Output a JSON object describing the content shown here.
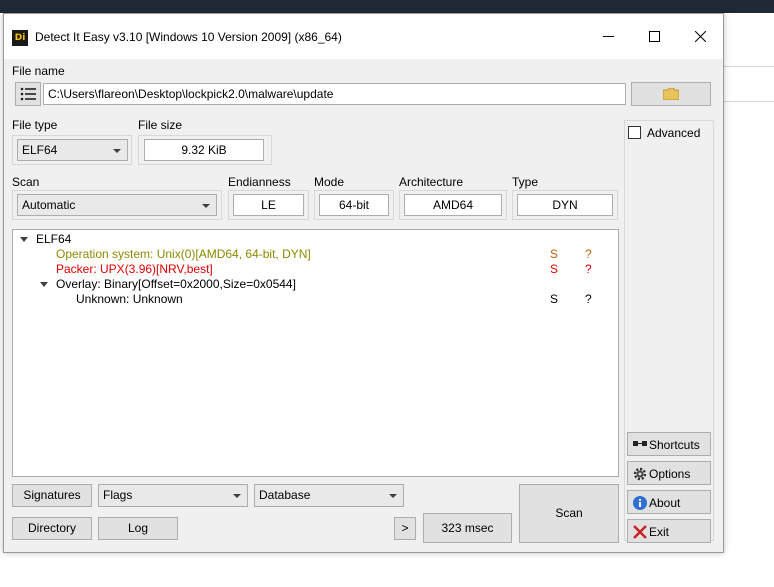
{
  "window": {
    "title": "Detect It Easy v3.10 [Windows 10 Version 2009] (x86_64)",
    "icon_text": "Di",
    "controls": [
      "minimize-icon",
      "maximize-icon",
      "close-icon"
    ]
  },
  "file_name": {
    "label": "File name",
    "value": "C:\\Users\\flareon\\Desktop\\lockpick2.0\\malware\\update"
  },
  "file_type": {
    "label": "File type",
    "value": "ELF64"
  },
  "file_size": {
    "label": "File size",
    "value": "9.32 KiB"
  },
  "scan": {
    "label": "Scan",
    "value": "Automatic"
  },
  "endianness": {
    "label": "Endianness",
    "value": "LE"
  },
  "mode": {
    "label": "Mode",
    "value": "64-bit"
  },
  "architecture": {
    "label": "Architecture",
    "value": "AMD64"
  },
  "type": {
    "label": "Type",
    "value": "DYN"
  },
  "advanced": {
    "label": "Advanced",
    "checked": false
  },
  "results": [
    {
      "text": "ELF64",
      "level": 0,
      "color": "#000000",
      "s": "",
      "q": "",
      "expanded": true
    },
    {
      "text": "Operation system: Unix(0)[AMD64, 64-bit, DYN]",
      "level": 1,
      "color": "#8a8a00",
      "s": "S",
      "q": "?",
      "s_color": "#c0640a",
      "q_color": "#c0640a"
    },
    {
      "text": "Packer: UPX(3.96)[NRV,best]",
      "level": 1,
      "color": "#e00000",
      "s": "S",
      "q": "?",
      "s_color": "#e00000",
      "q_color": "#e00000"
    },
    {
      "text": "Overlay: Binary[Offset=0x2000,Size=0x0544]",
      "level": 1,
      "color": "#000000",
      "s": "",
      "q": "",
      "expanded": true
    },
    {
      "text": "Unknown: Unknown",
      "level": 2,
      "color": "#000000",
      "s": "S",
      "q": "?",
      "s_color": "#000000",
      "q_color": "#000000"
    }
  ],
  "side_buttons": {
    "shortcuts": "Shortcuts",
    "options": "Options",
    "about": "About",
    "exit": "Exit"
  },
  "bottom": {
    "signatures": "Signatures",
    "flags": "Flags",
    "database": "Database",
    "directory": "Directory",
    "log": "Log",
    "more": ">",
    "elapsed": "323 msec",
    "scan": "Scan"
  },
  "colors": {
    "titlebar_bg": "#ffffff",
    "window_bg": "#f0f0f0",
    "warning_yellow": "#8a8a00",
    "packer_red": "#e00000"
  }
}
